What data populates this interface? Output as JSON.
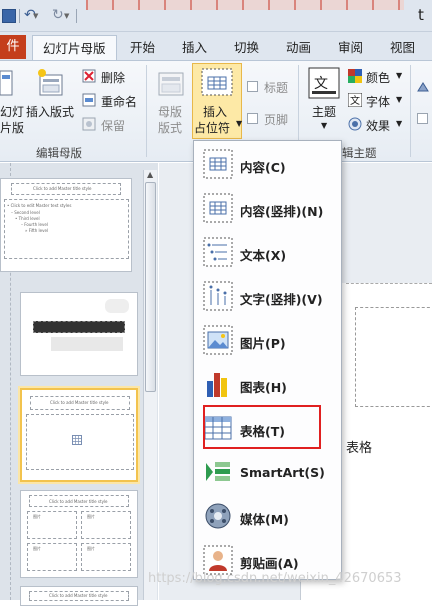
{
  "qat": {
    "window_title": "t"
  },
  "tabs": {
    "file": "件",
    "items": [
      "幻灯片母版",
      "开始",
      "插入",
      "切换",
      "动画",
      "审阅",
      "视图"
    ]
  },
  "ribbon": {
    "edit_master": {
      "insert_slide_master_l1": "幻灯",
      "insert_slide_master_l2": "片版",
      "insert_layout": "插入版式",
      "delete": "删除",
      "rename": "重命名",
      "preserve": "保留",
      "group_label": "编辑母版"
    },
    "master_layout": {
      "master_l1": "母版",
      "master_l2": "版式",
      "insert_l1": "插入",
      "insert_l2": "占位符",
      "title": "标题",
      "footer": "页脚"
    },
    "edit_theme": {
      "themes": "主题",
      "colors": "颜色",
      "fonts": "字体",
      "effects": "效果",
      "group_label": "辑主题"
    }
  },
  "thumbnails": {
    "t1_title": "Click to add Master title style",
    "t1_l1": "• Click to edit Master text styles",
    "t1_l2": "– Second level",
    "t1_l3": "• Third level",
    "t1_l4": "– Fourth level",
    "t1_l5": "» Fifth level",
    "t3_title": "Click to add Master title style",
    "t4_title": "Click to add Master title style",
    "t4_cells": [
      "图片",
      "图片",
      "图片",
      "图片"
    ],
    "t5_title": "Click to add Master title style"
  },
  "dropdown": {
    "items": [
      "内容(C)",
      "内容(竖排)(N)",
      "文本(X)",
      "文字(竖排)(V)",
      "图片(P)",
      "图表(H)",
      "表格(T)",
      "SmartArt(S)",
      "媒体(M)",
      "剪贴画(A)"
    ]
  },
  "annotation": {
    "caption": "表格"
  },
  "watermark": "https://blog.csdn.net/weixin_42670653",
  "colors": {
    "accent_file_tab": "#c43e1c",
    "highlight_border": "#e02020",
    "selected_thumb": "#f2c34e"
  }
}
